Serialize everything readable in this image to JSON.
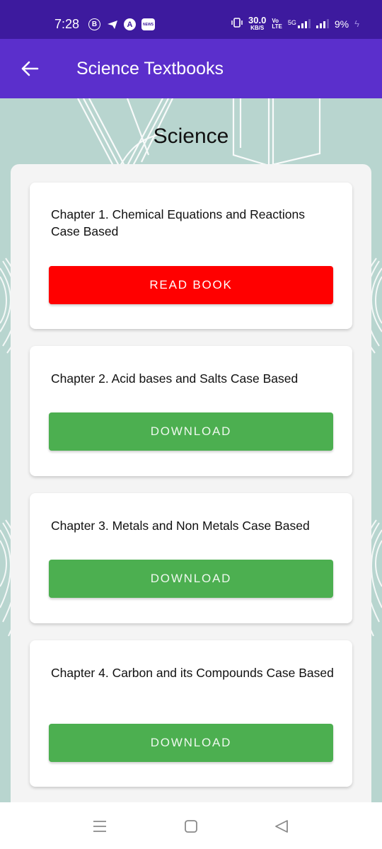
{
  "status_bar": {
    "time": "7:28",
    "notification_icons": [
      "b-chat-icon",
      "telegram-icon",
      "arc-icon",
      "news-icon"
    ],
    "notification_badge_text": "NEWS",
    "net_speed_value": "30.0",
    "net_speed_unit": "KB/S",
    "volte_top": "Vo",
    "volte_bottom": "LTE",
    "network_type": "5G",
    "battery": "9%"
  },
  "app_bar": {
    "title": "Science Textbooks",
    "back_icon": "arrow-left-icon"
  },
  "page": {
    "heading": "Science"
  },
  "colors": {
    "status_bar": "#3d1a9e",
    "app_bar": "#5b2fcc",
    "background": "#b8d5cf",
    "read_button": "#ff0000",
    "download_button": "#4caf50"
  },
  "chapters": [
    {
      "title": "Chapter 1. Chemical Equations and Reactions Case Based",
      "button_label": "READ BOOK"
    },
    {
      "title": "Chapter 2. Acid bases and Salts Case Based",
      "button_label": "DOWNLOAD"
    },
    {
      "title": "Chapter 3. Metals and Non Metals Case Based",
      "button_label": "DOWNLOAD"
    },
    {
      "title": "Chapter 4. Carbon and its Compounds Case Based",
      "button_label": "DOWNLOAD"
    }
  ],
  "nav_bar": {
    "buttons": [
      "recents-icon",
      "home-icon",
      "back-triangle-icon"
    ]
  }
}
